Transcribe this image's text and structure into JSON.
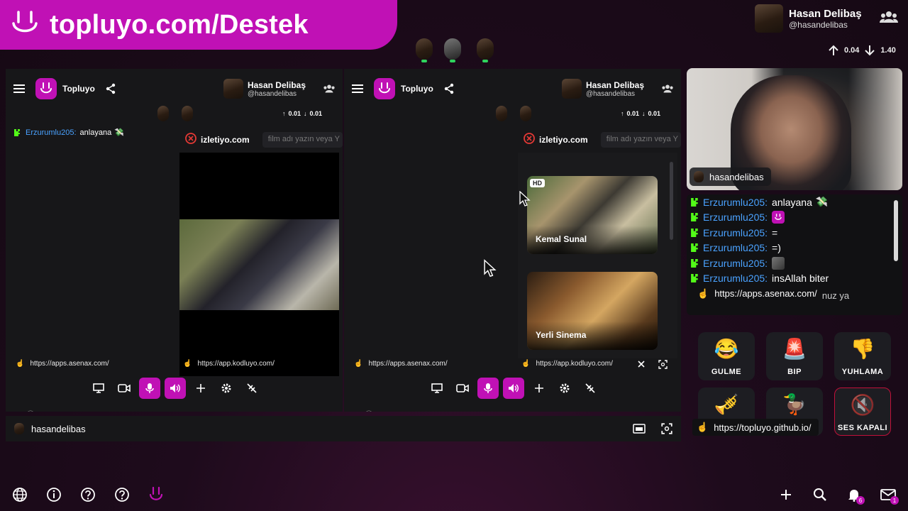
{
  "banner": {
    "text": "topluyo.com/Destek"
  },
  "top_user": {
    "name": "Hasan Delibaş",
    "handle": "@hasandelibas",
    "upload": "0.04",
    "download": "1.40"
  },
  "panels": [
    {
      "app_name": "Topluyo",
      "user_name": "Hasan Delibaş",
      "user_handle": "@hasandelibas",
      "upload": "0.01",
      "download": "0.01",
      "site_name": "izletiyo.com",
      "search_placeholder": "film adı yazın veya Y",
      "chat_user": "Erzurumlu205:",
      "chat_text": "anlayana",
      "left_url": "https://apps.asenax.com/",
      "right_url": "https://app.kodluyo.com/"
    },
    {
      "app_name": "Topluyo",
      "user_name": "Hasan Delibaş",
      "user_handle": "@hasandelibas",
      "upload": "0.01",
      "download": "0.01",
      "site_name": "izletiyo.com",
      "search_placeholder": "film adı yazın veya Y",
      "left_url": "https://apps.asenax.com/",
      "right_url": "https://app.kodluyo.com/",
      "movies": [
        {
          "title": "Kemal Sunal",
          "badge": "HD"
        },
        {
          "title": "Yerli Sinema"
        }
      ]
    }
  ],
  "stream_user": "hasandelibas",
  "cam_label": "hasandelibas",
  "chat": [
    {
      "user": "Erzurumlu205:",
      "text": "anlayana"
    },
    {
      "user": "Erzurumlu205:",
      "text": ""
    },
    {
      "user": "Erzurumlu205:",
      "text": "="
    },
    {
      "user": "Erzurumlu205:",
      "text": "=)"
    },
    {
      "user": "Erzurumlu205:",
      "text": ""
    },
    {
      "user": "Erzurumlu205:",
      "text": "insAllah biter"
    }
  ],
  "chat_tooltip": "https://apps.asenax.com/",
  "chat_partial": "...nuz ya",
  "reactions": [
    {
      "label": "GULME",
      "icon": "laughing-face-icon"
    },
    {
      "label": "BIP",
      "icon": "siren-icon"
    },
    {
      "label": "YUHLAMA",
      "icon": "thumbs-down-icon"
    },
    {
      "label": "",
      "icon": "trumpet-icon"
    },
    {
      "label": "",
      "icon": "duck-icon"
    },
    {
      "label": "SES KAPALI",
      "icon": "muted-speaker-icon"
    }
  ],
  "reaction_tooltip": "https://topluyo.github.io/",
  "notification_count": "6",
  "mail_count": "1",
  "colors": {
    "brand": "#c011b5",
    "chat_name": "#4aa2ff",
    "kick_green": "#53fc18"
  }
}
